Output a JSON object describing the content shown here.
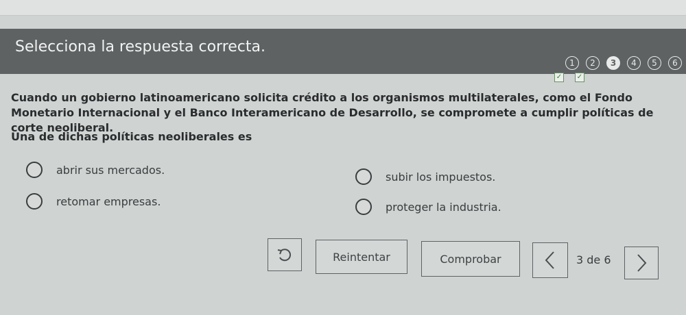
{
  "header": {
    "title": "Selecciona la respuesta correcta."
  },
  "steps": [
    {
      "label": "1",
      "state": "default"
    },
    {
      "label": "2",
      "state": "default"
    },
    {
      "label": "3",
      "state": "current"
    },
    {
      "label": "4",
      "state": "default"
    },
    {
      "label": "5",
      "state": "default"
    },
    {
      "label": "6",
      "state": "default"
    }
  ],
  "question": {
    "text": "Cuando un gobierno latinoamericano solicita crédito a los organismos multilaterales, como el Fondo Monetario Internacional y el Banco Interamericano de Desarrollo, se compromete a cumplir políticas de corte neoliberal.",
    "prompt": "Una de dichas políticas neoliberales es"
  },
  "options": {
    "a": "abrir sus mercados.",
    "b": "subir los impuestos.",
    "c": "retomar empresas.",
    "d": "proteger la industria."
  },
  "actions": {
    "undo_icon": "undo-icon",
    "retry_label": "Reintentar",
    "check_label": "Comprobar",
    "prev_icon": "chevron-left-icon",
    "next_icon": "chevron-right-icon",
    "page_indicator": "3 de 6"
  },
  "colors": {
    "header_bg": "#5e6263",
    "page_bg": "#cfd3d2"
  }
}
